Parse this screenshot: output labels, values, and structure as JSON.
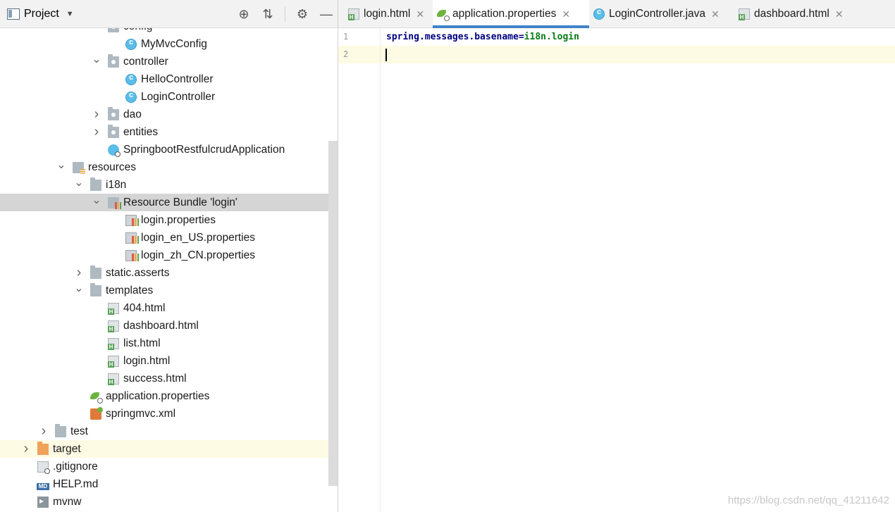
{
  "project_panel": {
    "title": "Project",
    "tools": [
      "locate-icon",
      "collapse-icon",
      "gear-icon",
      "minimize-icon"
    ]
  },
  "tree": [
    {
      "label": "config",
      "icon": "package",
      "arrow": "down",
      "indent": 1
    },
    {
      "label": "MyMvcConfig",
      "icon": "class",
      "arrow": "none",
      "indent": 2
    },
    {
      "label": "controller",
      "icon": "package",
      "arrow": "down",
      "indent": 1
    },
    {
      "label": "HelloController",
      "icon": "class",
      "arrow": "none",
      "indent": 2
    },
    {
      "label": "LoginController",
      "icon": "class",
      "arrow": "none",
      "indent": 2
    },
    {
      "label": "dao",
      "icon": "package",
      "arrow": "right",
      "indent": 1
    },
    {
      "label": "entities",
      "icon": "package",
      "arrow": "right",
      "indent": 1
    },
    {
      "label": "SpringbootRestfulcrudApplication",
      "icon": "app",
      "arrow": "none",
      "indent": 1
    },
    {
      "label": "resources",
      "icon": "resources",
      "arrow": "down",
      "indent": -1
    },
    {
      "label": "i18n",
      "icon": "folder",
      "arrow": "down",
      "indent": 0
    },
    {
      "label": "Resource Bundle 'login'",
      "icon": "bundle",
      "arrow": "down",
      "indent": 1,
      "selected": true
    },
    {
      "label": "login.properties",
      "icon": "props",
      "arrow": "none",
      "indent": 2
    },
    {
      "label": "login_en_US.properties",
      "icon": "props",
      "arrow": "none",
      "indent": 2
    },
    {
      "label": "login_zh_CN.properties",
      "icon": "props",
      "arrow": "none",
      "indent": 2
    },
    {
      "label": "static.asserts",
      "icon": "folder",
      "arrow": "right",
      "indent": 0
    },
    {
      "label": "templates",
      "icon": "folder",
      "arrow": "down",
      "indent": 0
    },
    {
      "label": "404.html",
      "icon": "html",
      "arrow": "none",
      "indent": 1
    },
    {
      "label": "dashboard.html",
      "icon": "html",
      "arrow": "none",
      "indent": 1
    },
    {
      "label": "list.html",
      "icon": "html",
      "arrow": "none",
      "indent": 1
    },
    {
      "label": "login.html",
      "icon": "html",
      "arrow": "none",
      "indent": 1
    },
    {
      "label": "success.html",
      "icon": "html",
      "arrow": "none",
      "indent": 1
    },
    {
      "label": "application.properties",
      "icon": "spring",
      "arrow": "none",
      "indent": 0
    },
    {
      "label": "springmvc.xml",
      "icon": "xml",
      "arrow": "none",
      "indent": 0
    },
    {
      "label": "test",
      "icon": "folder",
      "arrow": "right",
      "indent": -2
    },
    {
      "label": "target",
      "icon": "target",
      "arrow": "right",
      "indent": -3,
      "highlight": true
    },
    {
      "label": ".gitignore",
      "icon": "gitignore",
      "arrow": "none",
      "indent": -3
    },
    {
      "label": "HELP.md",
      "icon": "md",
      "arrow": "none",
      "indent": -3
    },
    {
      "label": "mvnw",
      "icon": "exec",
      "arrow": "none",
      "indent": -3
    }
  ],
  "tabs": [
    {
      "label": "login.html",
      "icon": "html",
      "active": false
    },
    {
      "label": "application.properties",
      "icon": "spring",
      "active": true
    },
    {
      "label": "LoginController.java",
      "icon": "class",
      "active": false
    },
    {
      "label": "dashboard.html",
      "icon": "html",
      "active": false
    }
  ],
  "editor": {
    "line_numbers": [
      "1",
      "2"
    ],
    "line1_key": "spring.messages.basename",
    "line1_eq": "=",
    "line1_value": "i18n.login"
  },
  "watermark": "https://blog.csdn.net/qq_41211642"
}
